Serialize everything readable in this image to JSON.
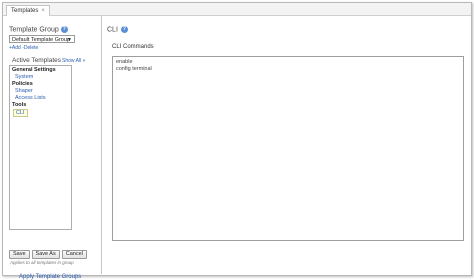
{
  "tabs": {
    "active_label": "Templates",
    "close_glyph": "×"
  },
  "left_panel": {
    "template_group_label": "Template Group",
    "help_glyph": "?",
    "selected_group": "Default Template Group",
    "add_link": "+Add",
    "delete_link": "-Delete",
    "active_templates_label": "Active Templates",
    "show_all_link": "Show All »",
    "tree": [
      {
        "group": "General Settings",
        "items": [
          "System"
        ]
      },
      {
        "group": "Policies",
        "items": [
          "Shaper",
          "Access Lists"
        ]
      },
      {
        "group": "Tools",
        "items": [
          "CLI"
        ]
      }
    ],
    "buttons": {
      "save": "Save",
      "save_as": "Save As",
      "cancel": "Cancel"
    },
    "note": "Applies to all templates in group",
    "apply_link": "Apply Template Groups"
  },
  "right_panel": {
    "title": "CLI",
    "help_glyph": "?",
    "commands_label": "CLI Commands",
    "commands": [
      "enable",
      "config terminal"
    ]
  },
  "colors": {
    "link": "#2a5db0",
    "help": "#5a8fd8",
    "selected_item": "#ffffe0"
  }
}
